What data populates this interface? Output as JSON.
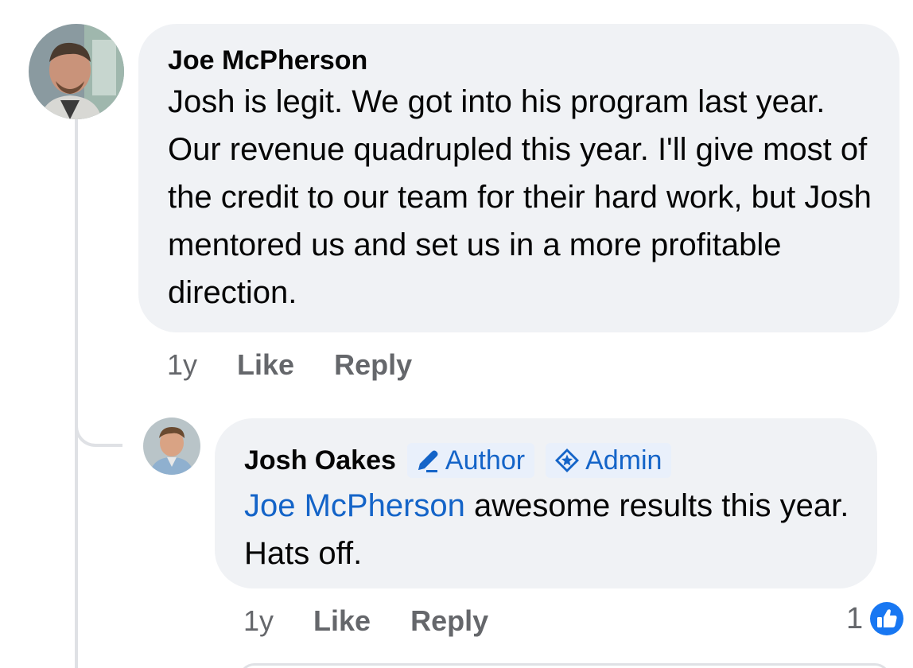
{
  "comments": [
    {
      "author": "Joe McPherson",
      "text": "Josh is legit. We got into his program last year. Our revenue quadrupled this year. I'll give most of the credit to our team for their hard work, but Josh mentored us and set us in a more profitable direction.",
      "time": "1y",
      "like_label": "Like",
      "reply_label": "Reply"
    }
  ],
  "reply": {
    "author": "Josh Oakes",
    "badges": {
      "author": "Author",
      "admin": "Admin"
    },
    "mention": "Joe McPherson",
    "text": " awesome results this year. Hats off.",
    "time": "1y",
    "like_label": "Like",
    "reply_label": "Reply",
    "reaction_count": "1",
    "reaction_icon": "thumbs-up-icon"
  },
  "colors": {
    "bubble": "#f0f2f5",
    "link_blue": "#1464c8",
    "meta_gray": "#65676b",
    "like_blue": "#1877f2"
  }
}
